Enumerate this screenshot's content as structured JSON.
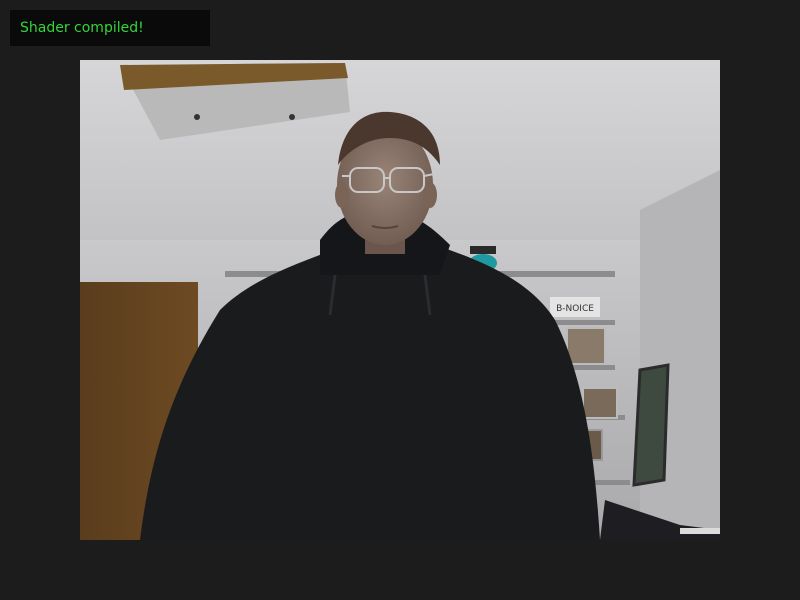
{
  "status": {
    "message": "Shader compiled!",
    "message_color": "#35d43a"
  },
  "video": {
    "sign_text": "B-NOICE"
  }
}
